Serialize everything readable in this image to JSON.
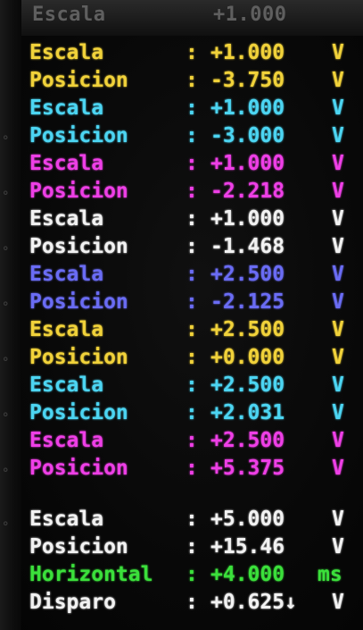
{
  "colors": {
    "yellow": "#f1d23a",
    "cyan": "#4cd5f2",
    "magenta": "#ee3fe6",
    "white": "#f2f2f2",
    "blue": "#6a6cf4",
    "green": "#3be03b"
  },
  "header_ghost": {
    "label": "Escala",
    "value": "+1.000"
  },
  "rows": [
    {
      "label": "Escala",
      "sep": ":",
      "value": "+1.000",
      "unit": "V",
      "color": "#f1d23a"
    },
    {
      "label": "Posicion",
      "sep": ":",
      "value": "-3.750",
      "unit": "V",
      "color": "#f1d23a"
    },
    {
      "label": "Escala",
      "sep": ":",
      "value": "+1.000",
      "unit": "V",
      "color": "#4cd5f2"
    },
    {
      "label": "Posicion",
      "sep": ":",
      "value": "-3.000",
      "unit": "V",
      "color": "#4cd5f2"
    },
    {
      "label": "Escala",
      "sep": ":",
      "value": "+1.000",
      "unit": "V",
      "color": "#ee3fe6"
    },
    {
      "label": "Posicion",
      "sep": ":",
      "value": "-2.218",
      "unit": "V",
      "color": "#ee3fe6"
    },
    {
      "label": "Escala",
      "sep": ":",
      "value": "+1.000",
      "unit": "V",
      "color": "#f2f2f2"
    },
    {
      "label": "Posicion",
      "sep": ":",
      "value": "-1.468",
      "unit": "V",
      "color": "#f2f2f2"
    },
    {
      "label": "Escala",
      "sep": ":",
      "value": "+2.500",
      "unit": "V",
      "color": "#6a6cf4"
    },
    {
      "label": "Posicion",
      "sep": ":",
      "value": "-2.125",
      "unit": "V",
      "color": "#6a6cf4"
    },
    {
      "label": "Escala",
      "sep": ":",
      "value": "+2.500",
      "unit": "V",
      "color": "#f1d23a"
    },
    {
      "label": "Posicion",
      "sep": ":",
      "value": "+0.000",
      "unit": "V",
      "color": "#f1d23a"
    },
    {
      "label": "Escala",
      "sep": ":",
      "value": "+2.500",
      "unit": "V",
      "color": "#4cd5f2"
    },
    {
      "label": "Posicion",
      "sep": ":",
      "value": "+2.031",
      "unit": "V",
      "color": "#4cd5f2"
    },
    {
      "label": "Escala",
      "sep": ":",
      "value": "+2.500",
      "unit": "V",
      "color": "#ee3fe6"
    },
    {
      "label": "Posicion",
      "sep": ":",
      "value": "+5.375",
      "unit": "V",
      "color": "#ee3fe6"
    },
    {
      "label": "Escala",
      "sep": ":",
      "value": "+5.000",
      "unit": "V",
      "color": "#f2f2f2"
    },
    {
      "label": "Posicion",
      "sep": ":",
      "value": "+15.46",
      "unit": "V",
      "color": "#f2f2f2"
    },
    {
      "label": "Horizontal",
      "sep": ":",
      "value": "+4.000",
      "unit": "ms",
      "color": "#3be03b"
    },
    {
      "label": "Disparo",
      "sep": ":",
      "value": "+0.625↓",
      "unit": "V",
      "color": "#f2f2f2"
    }
  ]
}
